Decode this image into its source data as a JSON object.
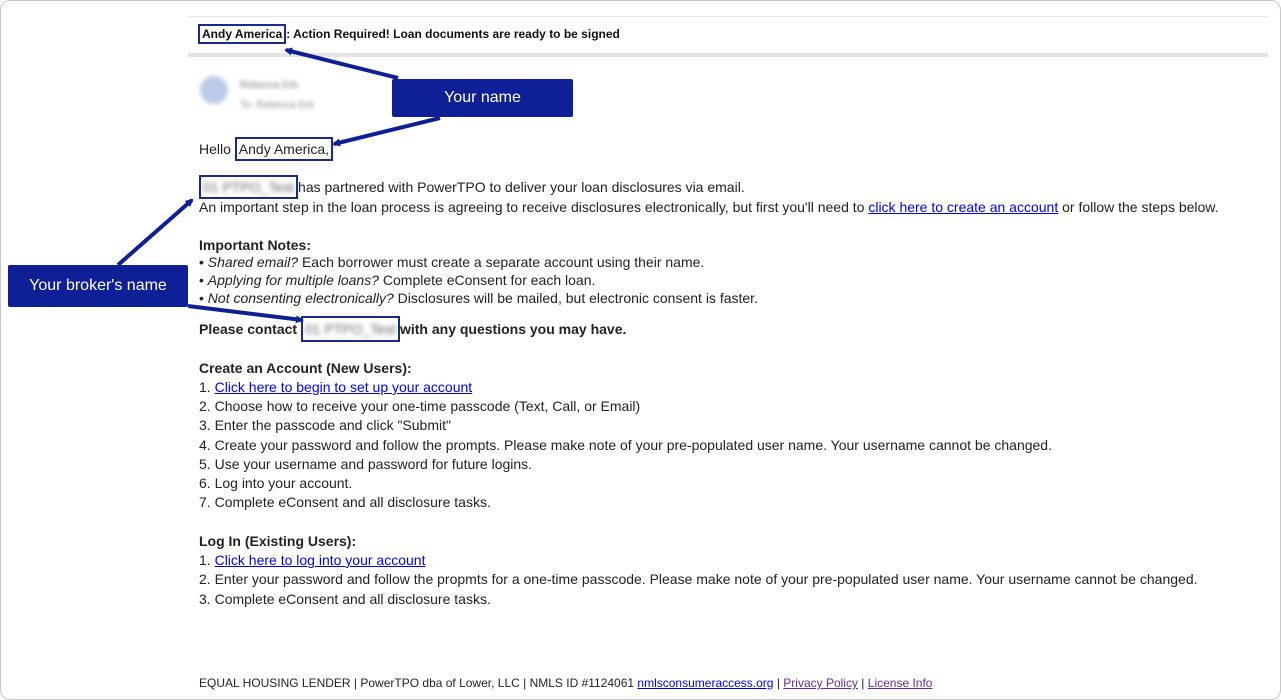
{
  "email": {
    "subject_name": "Andy America",
    "subject_sep": ":",
    "subject_rest": " Action Required! Loan documents are ready to be signed",
    "sender_name": "Rebecca Erb",
    "sender_to": "To: Rebecca Erb",
    "greeting_prefix": "Hello ",
    "greeting_name": "Andy America,",
    "broker_name": "01 PTPO_Test",
    "intro_suffix": "has partnered with PowerTPO to deliver your loan disclosures via email.",
    "step_text": "An important step in the loan process is agreeing to receive disclosures electronically, but first you'll need to ",
    "step_link": "click here to create an account",
    "step_suffix": " or follow the steps below.",
    "notes_heading": "Important Notes:",
    "notes": [
      {
        "em": "Shared email?",
        "text": " Each borrower must create a separate account using their name."
      },
      {
        "em": "Applying for multiple loans?",
        "text": " Complete eConsent for each loan."
      },
      {
        "em": "Not consenting electronically?",
        "text": " Disclosures will be mailed, but electronic consent is faster."
      }
    ],
    "contact_prefix": "Please contact ",
    "contact_name": "01 PTPO_Test",
    "contact_suffix": "with any questions you may have.",
    "create_heading": "Create an Account (New Users):",
    "create_steps": [
      {
        "num": "1. ",
        "link": "Click here to begin to set up your account"
      },
      {
        "num": "2. ",
        "text": "Choose how to receive your one-time passcode (Text, Call, or Email)"
      },
      {
        "num": "3. ",
        "text": "Enter the passcode and click \"Submit\""
      },
      {
        "num": "4. ",
        "text": "Create your password and follow the prompts. Please make note of your pre-populated user name. Your username cannot be changed."
      },
      {
        "num": "5. ",
        "text": "Use your username and password for future logins."
      },
      {
        "num": "6. ",
        "text": "Log into your account."
      },
      {
        "num": "7. ",
        "text": "Complete eConsent and all disclosure tasks."
      }
    ],
    "login_heading": "Log In (Existing Users):",
    "login_steps": [
      {
        "num": "1. ",
        "link": "Click here to log into your account"
      },
      {
        "num": "2. ",
        "text": "Enter your password and follow the propmts for a one-time passcode. Please make note of your pre-populated user name. Your username cannot be changed."
      },
      {
        "num": "3. ",
        "text": "Complete eConsent and all disclosure tasks."
      }
    ],
    "footer_text": "EQUAL HOUSING LENDER | PowerTPO dba of Lower, LLC | NMLS ID #1124061 ",
    "footer_link1": "nmlsconsumeraccess.org",
    "footer_sep1": " | ",
    "footer_link2": "Privacy Policy",
    "footer_sep2": " | ",
    "footer_link3": "License Info"
  },
  "callouts": {
    "your_name": "Your name",
    "broker_name": "Your broker's name"
  },
  "colors": {
    "callout_bg": "#0f1f96",
    "link": "#0000ee",
    "visited_link": "#6b2a9a"
  }
}
